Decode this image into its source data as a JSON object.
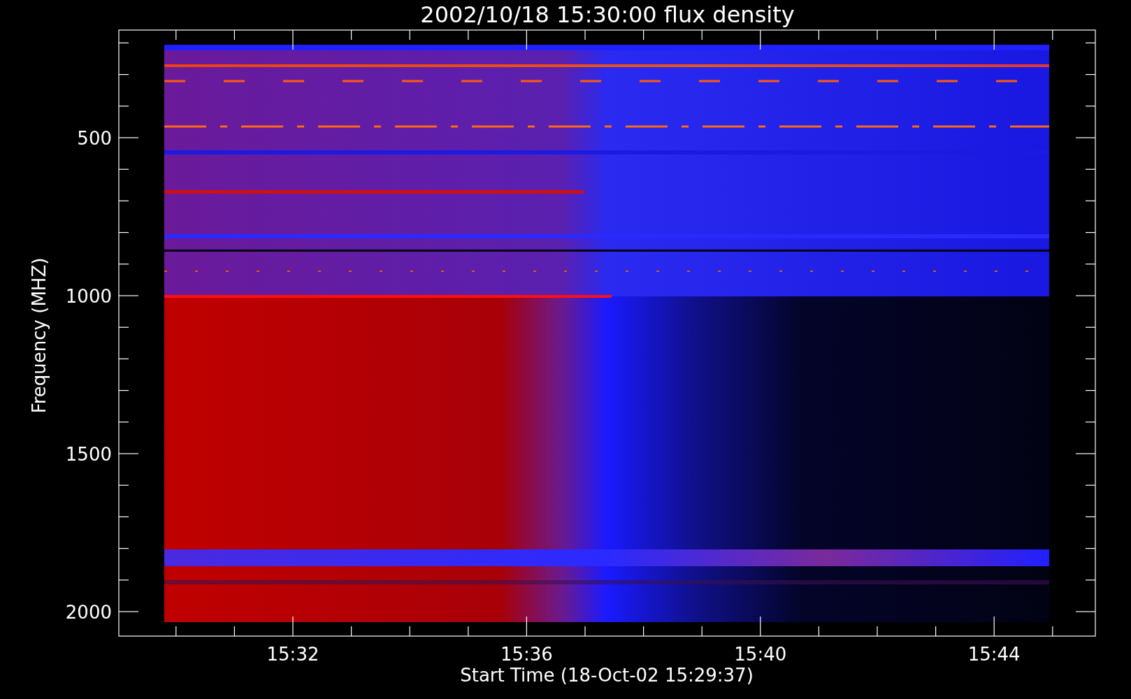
{
  "title": "2002/10/18 15:30:00 flux density",
  "y_axis": {
    "label": "Frequency (MHZ)",
    "ticks": [
      "500",
      "1000",
      "1500",
      "2000"
    ]
  },
  "x_axis": {
    "label": "Start Time (18-Oct-02 15:29:37)",
    "ticks": [
      "15:32",
      "15:36",
      "15:40",
      "15:44"
    ]
  }
}
